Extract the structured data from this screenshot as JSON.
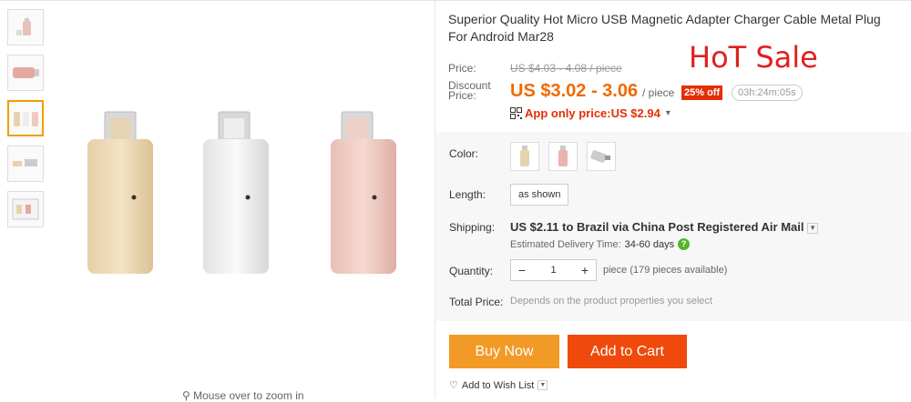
{
  "product": {
    "title": "Superior Quality Hot Micro USB Magnetic Adapter Charger Cable Metal Plug For Android Mar28",
    "promo_text": "HoT Sale"
  },
  "gallery": {
    "thumbnails": [
      "gold-silver-rose-adapters",
      "rose-adapter-side",
      "three-adapters",
      "adapter-connect",
      "adapter-detail"
    ],
    "zoom_hint": "Mouse over to zoom in"
  },
  "price": {
    "price_label": "Price:",
    "old_price": "US $4.03 - 4.08 / piece",
    "discount_label_1": "Discount",
    "discount_label_2": "Price:",
    "new_price": "US $3.02 - 3.06",
    "per_piece": "/ piece",
    "discount_badge": "25% off",
    "timer": "03h:24m:05s",
    "app_price": "App only price:US $2.94",
    "accent_color": "#ef6a00",
    "badge_color": "#e62e04"
  },
  "options": {
    "color_label": "Color:",
    "length_label": "Length:",
    "length_value": "as shown",
    "shipping_label": "Shipping:",
    "shipping_price": "US $2.11",
    "shipping_dest": "to Brazil via China Post Registered Air Mail",
    "delivery_label": "Estimated Delivery Time:",
    "delivery_days": "34-60 days",
    "quantity_label": "Quantity:",
    "quantity_value": "1",
    "quantity_minus": "−",
    "quantity_plus": "+",
    "availability": "piece (179 pieces available)",
    "total_label": "Total Price:",
    "total_note": "Depends on the product properties you select"
  },
  "actions": {
    "buy_now": "Buy Now",
    "add_to_cart": "Add to Cart",
    "wish_list": "Add to Wish List",
    "buy_color": "#f29a26",
    "cart_color": "#ef4a0c"
  }
}
